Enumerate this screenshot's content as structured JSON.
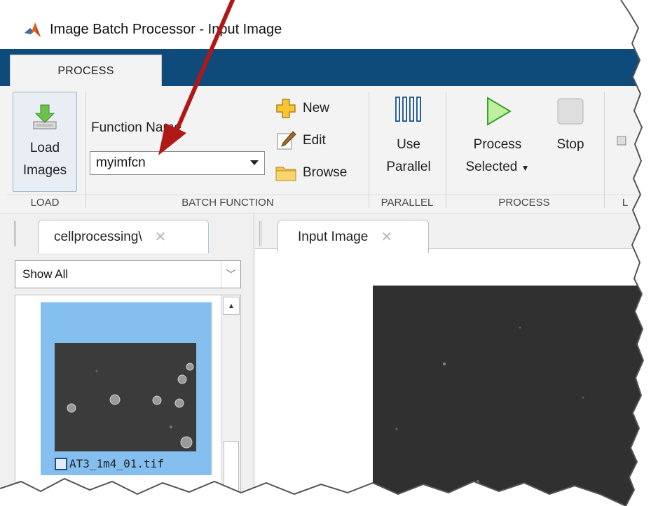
{
  "window": {
    "title": "Image Batch Processor - Input Image"
  },
  "ribbon": {
    "tab": "PROCESS",
    "load": {
      "label_line1": "Load",
      "label_line2": "Images",
      "section": "LOAD"
    },
    "batch_function": {
      "field_label": "Function Name",
      "selected": "myimfcn",
      "new_label": "New",
      "edit_label": "Edit",
      "browse_label": "Browse",
      "section": "BATCH FUNCTION"
    },
    "parallel": {
      "label_line1": "Use",
      "label_line2": "Parallel",
      "section": "PARALLEL"
    },
    "process": {
      "process_line1": "Process",
      "process_line2": "Selected",
      "stop_label": "Stop",
      "section": "PROCESS"
    },
    "cut_section_letter": "L"
  },
  "left_pane": {
    "tab_label": "cellprocessing\\",
    "tab_close": "✕",
    "filter": "Show All",
    "thumbnails": [
      {
        "filename": "AT3_1m4_01.tif",
        "selected": true
      }
    ]
  },
  "right_pane": {
    "tab_label": "Input Image",
    "tab_close": "✕"
  },
  "colors": {
    "tab_strip": "#0e4a7a",
    "selection": "#84bff0",
    "arrow": "#b01818"
  }
}
